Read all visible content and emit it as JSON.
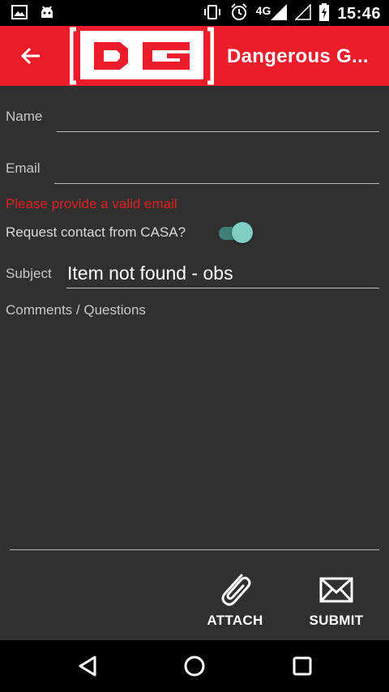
{
  "status_bar": {
    "time": "15:46",
    "network": "4G",
    "icons": [
      "image-notification-icon",
      "android-notification-icon",
      "vibrate-icon",
      "alarm-icon",
      "signal-icon",
      "signal-empty-icon",
      "battery-charging-icon"
    ]
  },
  "app_bar": {
    "title": "Dangerous G...",
    "logo_text": "DG",
    "color": "#ec1c2b"
  },
  "form": {
    "name_label": "Name",
    "name_value": "",
    "email_label": "Email",
    "email_value": "",
    "email_error": "Please provide a valid email",
    "contact_toggle_label": "Request contact from CASA?",
    "contact_toggle_on": true,
    "subject_label": "Subject",
    "subject_value": "Item not found - obs",
    "comments_placeholder": "Comments / Questions"
  },
  "actions": {
    "attach_label": "ATTACH",
    "submit_label": "SUBMIT"
  },
  "colors": {
    "background": "#303030",
    "accent_toggle": "#7ecec3",
    "error": "#e32020"
  }
}
